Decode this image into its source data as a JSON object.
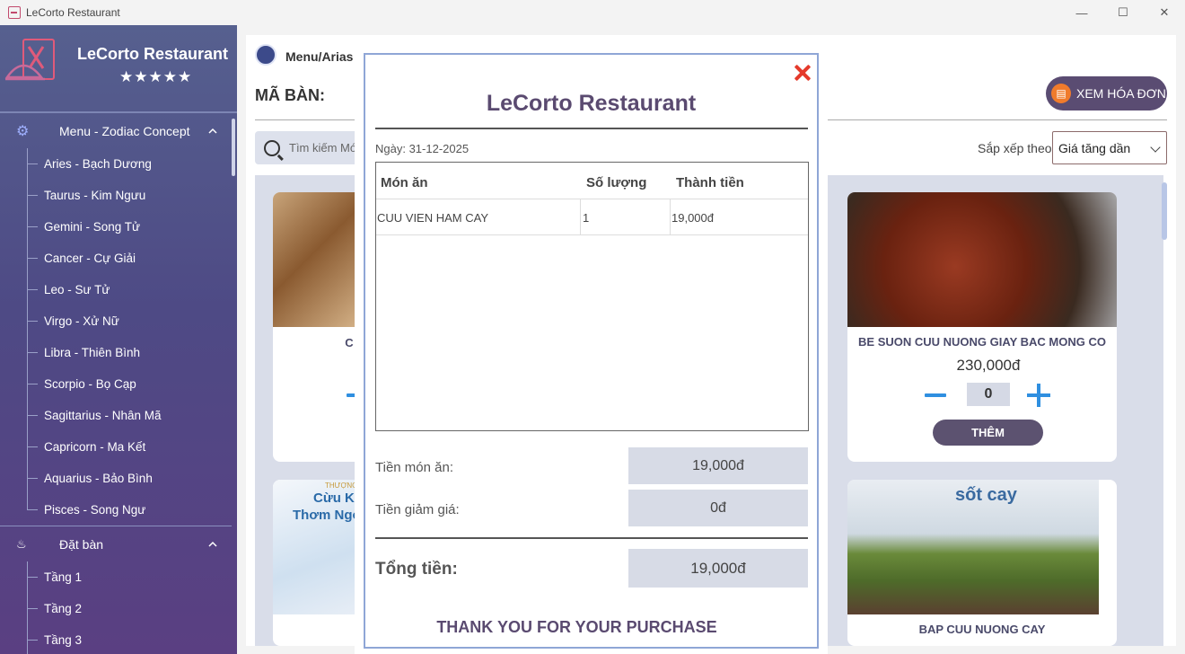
{
  "window": {
    "title": "LeCorto Restaurant",
    "minimize": "—",
    "maximize": "☐",
    "close": "✕"
  },
  "sidebar": {
    "brand_name": "LeCorto Restaurant",
    "stars": "★★★★★",
    "menu_section": {
      "label": "Menu - Zodiac Concept",
      "items": [
        "Aries - Bạch Dương",
        "Taurus - Kim Ngưu",
        "Gemini - Song Tử",
        "Cancer - Cự Giải",
        "Leo - Sư Tử",
        "Virgo - Xử Nữ",
        "Libra - Thiên Bình",
        "Scorpio - Bọ Cạp",
        "Sagittarius - Nhân Mã",
        "Capricorn - Ma Kết",
        "Aquarius - Bảo Bình",
        "Pisces - Song Ngư"
      ]
    },
    "booking_section": {
      "label": "Đặt bàn",
      "items": [
        "Tầng 1",
        "Tầng 2",
        "Tầng 3"
      ]
    }
  },
  "main": {
    "breadcrumb": "Menu/Arias",
    "table_label": "MÃ BÀN:",
    "view_bill_button": "XEM HÓA ĐƠN",
    "search_placeholder": "Tìm kiếm Mó",
    "sort_label": "Sắp xếp theo",
    "sort_value": "Giá tăng dần",
    "cards": [
      {
        "name": "C",
        "image": "clay-pot-dish-image"
      },
      {
        "name": "BE SUON CUU NUONG GIAY BAC MONG CO",
        "price": "230,000đ",
        "qty": "0",
        "add_label": "THÊM",
        "image": "grilled-lamb-ribs-image"
      },
      {
        "banner_top": "THƯỢNG T",
        "banner_line1": "Cừu Kung",
        "banner_line2": "Thơm Ngon Ki",
        "image": "lamb-promo-image"
      },
      {
        "name": "BAP CUU NUONG CAY",
        "banner": "sốt cay",
        "image": "grilled-lamb-shank-image"
      }
    ]
  },
  "invoice": {
    "title": "LeCorto Restaurant",
    "date": "Ngày: 31-12-2025",
    "columns": [
      "Món ăn",
      "Số lượng",
      "Thành tiền"
    ],
    "rows": [
      {
        "item": "CUU VIEN HAM CAY",
        "qty": "1",
        "amount": "19,000đ"
      }
    ],
    "food_total_label": "Tiền món ăn:",
    "food_total": "19,000đ",
    "discount_label": "Tiền giảm giá:",
    "discount": "0đ",
    "grand_total_label": "Tổng tiền:",
    "grand_total": "19,000đ",
    "thanks": "THANK YOU FOR YOUR PURCHASE"
  },
  "colors": {
    "sidebar_top": "#56608f",
    "sidebar_bottom": "#5a3f82",
    "accent_purple": "#5a4c72",
    "qty_blue": "#2f8fe0",
    "close_red": "#e53a2b"
  }
}
